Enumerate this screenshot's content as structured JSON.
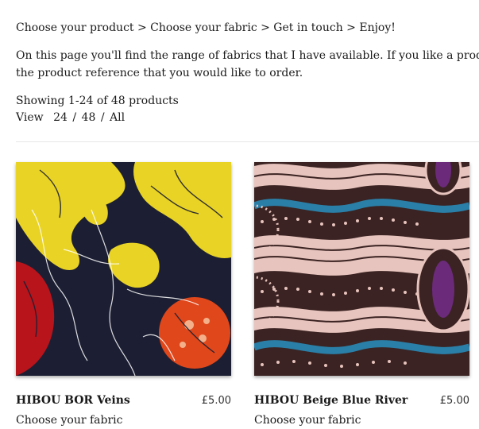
{
  "breadcrumb": "Choose your product > Choose your fabric > Get in touch > Enjoy!",
  "intro": {
    "line1": "On this page you'll find the range of fabrics that I have available. If you like a product and war",
    "line2": "the product reference that you would like to order."
  },
  "showing": "Showing 1-24 of 48 products",
  "view": {
    "label": "View",
    "options": [
      "24",
      "48",
      "All"
    ]
  },
  "products": [
    {
      "title": "HIBOU BOR Veins",
      "price": "£5.00",
      "cta": "Choose your fabric"
    },
    {
      "title": "HIBOU Beige Blue River",
      "price": "£5.00",
      "cta": "Choose your fabric"
    }
  ],
  "colors": {
    "text": "#1a1a1a",
    "divider": "#e6e6e6",
    "fabric1_navy": "#1c1f33",
    "fabric1_yellow": "#e9d324",
    "fabric1_red": "#b8141b",
    "fabric1_orange": "#e0471b",
    "fabric2_brown": "#3a2322",
    "fabric2_pink": "#e8c4be",
    "fabric2_blue": "#2a7fa8",
    "fabric2_purple": "#6b2a7a"
  }
}
